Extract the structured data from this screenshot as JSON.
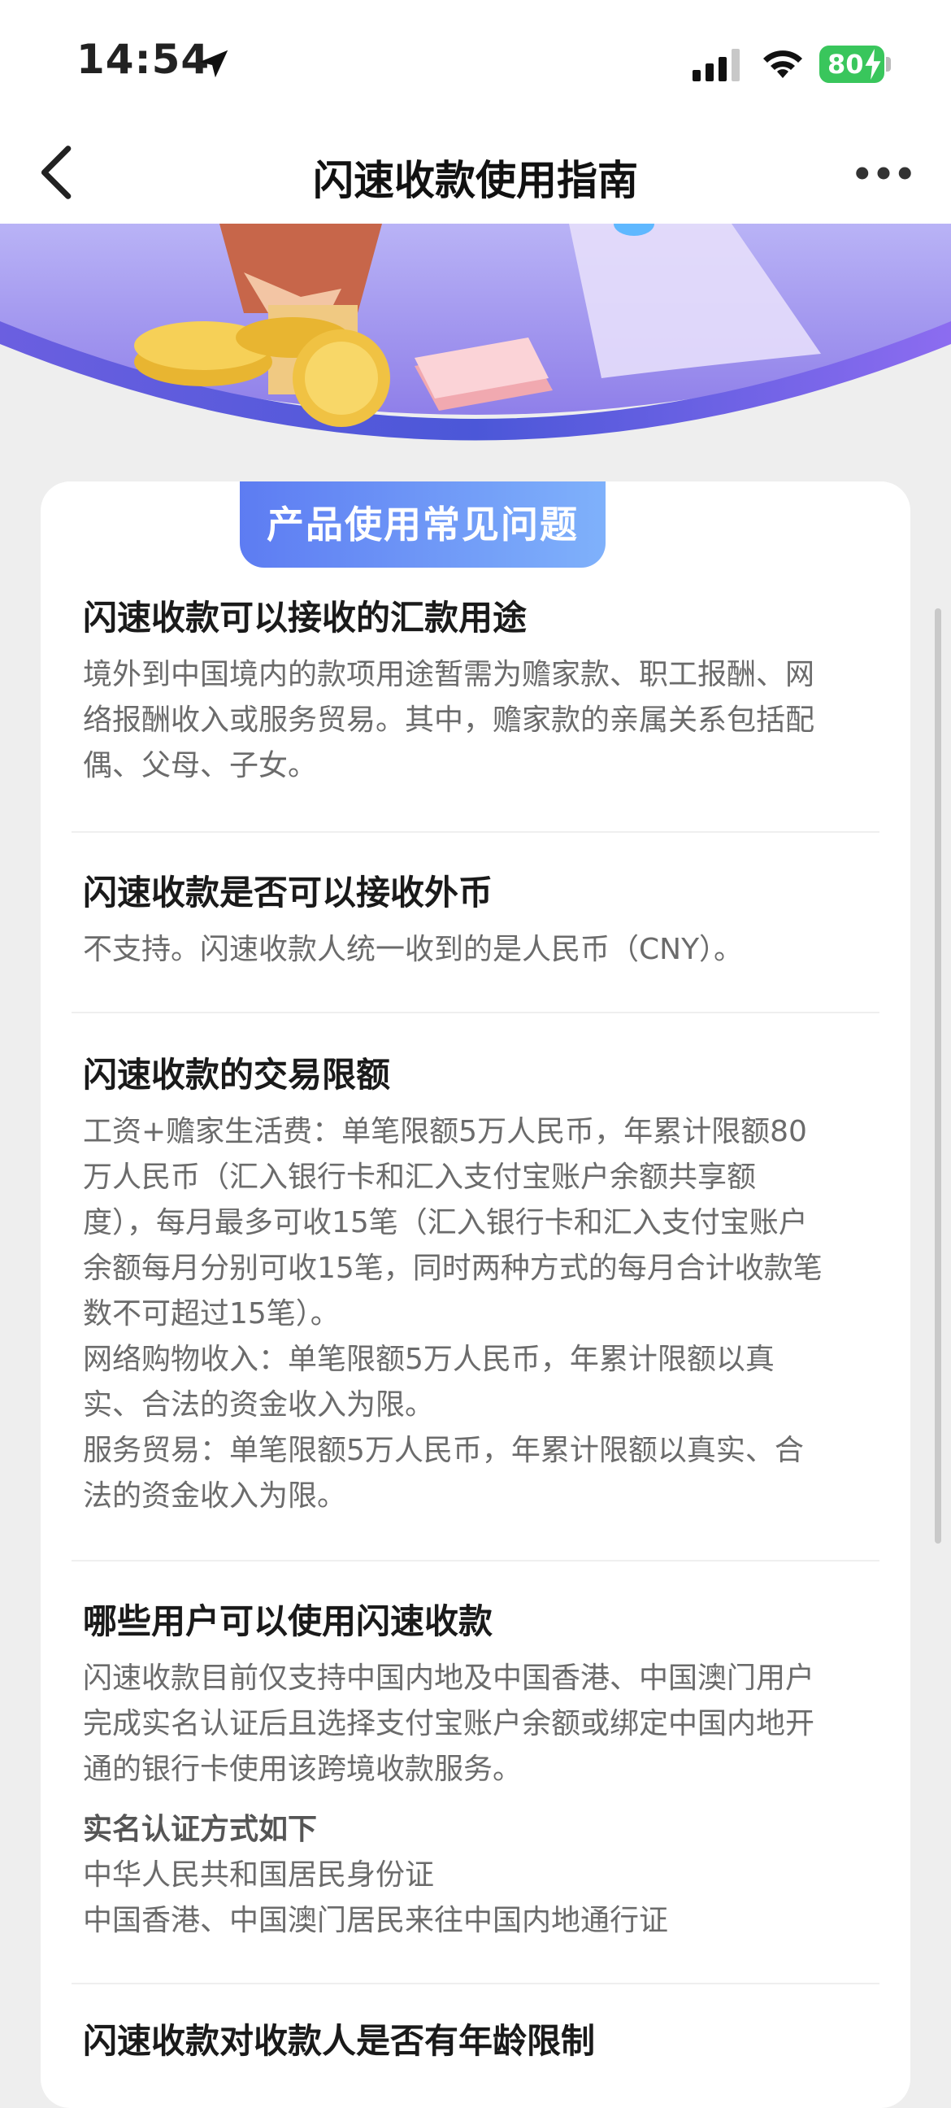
{
  "status_bar": {
    "time": "14:54",
    "battery": "80",
    "location_icon": "location-arrow-icon",
    "signal_icon": "cellular-signal-icon",
    "wifi_icon": "wifi-icon"
  },
  "nav": {
    "title": "闪速收款使用指南",
    "back_icon": "chevron-left-icon",
    "more_icon": "more-dots-icon"
  },
  "card": {
    "tab_label": "产品使用常见问题",
    "faqs": [
      {
        "question": "闪速收款可以接收的汇款用途",
        "answer": [
          "境外到中国境内的款项用途暂需为赡家款、职工报酬、网",
          "络报酬收入或服务贸易。其中，赡家款的亲属关系包括配",
          "偶、父母、子女。"
        ]
      },
      {
        "question": "闪速收款是否可以接收外币",
        "answer": [
          "不支持。闪速收款人统一收到的是人民币（CNY）。"
        ]
      },
      {
        "question": "闪速收款的交易限额",
        "answer": [
          "工资+赡家生活费：单笔限额5万人民币，年累计限额80",
          "万人民币（汇入银行卡和汇入支付宝账户余额共享额",
          "度），每月最多可收15笔（汇入银行卡和汇入支付宝账户",
          "余额每月分别可收15笔，同时两种方式的每月合计收款笔",
          "数不可超过15笔）。",
          "网络购物收入：单笔限额5万人民币，年累计限额以真",
          "实、合法的资金收入为限。",
          "服务贸易：单笔限额5万人民币，年累计限额以真实、合",
          "法的资金收入为限。"
        ]
      },
      {
        "question": "哪些用户可以使用闪速收款",
        "answer": [
          "闪速收款目前仅支持中国内地及中国香港、中国澳门用户",
          "完成实名认证后且选择支付宝账户余额或绑定中国内地开",
          "通的银行卡使用该跨境收款服务。"
        ],
        "subheading": "实名认证方式如下",
        "sub_answer": [
          "中华人民共和国居民身份证",
          "中国香港、中国澳门居民来往中国内地通行证"
        ]
      },
      {
        "question": "闪速收款对收款人是否有年龄限制"
      }
    ]
  },
  "colors": {
    "tab_gradient_start": "#5d7cf2",
    "tab_gradient_end": "#7fb1fb",
    "battery_green": "#39c65c",
    "banner_purple": "#7b6ee8"
  }
}
